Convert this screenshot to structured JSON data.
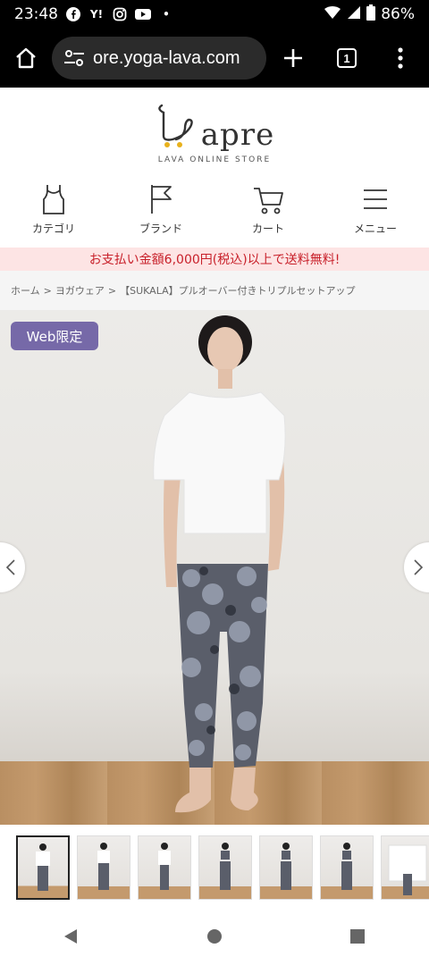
{
  "status_bar": {
    "time": "23:48",
    "battery": "86%",
    "notification_icons": [
      "facebook-icon",
      "yahoo-icon",
      "instagram-icon",
      "youtube-icon",
      "dot-icon"
    ]
  },
  "browser": {
    "url": "ore.yoga-lava.com",
    "tab_count": "1"
  },
  "logo": {
    "text": "apre",
    "subtitle": "LAVA ONLINE STORE"
  },
  "nav": {
    "items": [
      {
        "label": "カテゴリ",
        "icon": "tank-top-icon"
      },
      {
        "label": "ブランド",
        "icon": "flag-icon"
      },
      {
        "label": "カート",
        "icon": "cart-icon"
      },
      {
        "label": "メニュー",
        "icon": "menu-icon"
      }
    ]
  },
  "banner": {
    "text": "お支払い金額6,000円(税込)以上で送料無料!"
  },
  "breadcrumb": {
    "home": "ホーム",
    "category": "ヨガウェア",
    "product": "【SUKALA】プルオーバー付きトリプルセットアップ",
    "separator": ">"
  },
  "product": {
    "badge": "Web限定",
    "thumbnail_count": 7
  },
  "colors": {
    "badge": "#7669a8",
    "banner_bg": "#fde4e4",
    "banner_text": "#c8202a"
  }
}
